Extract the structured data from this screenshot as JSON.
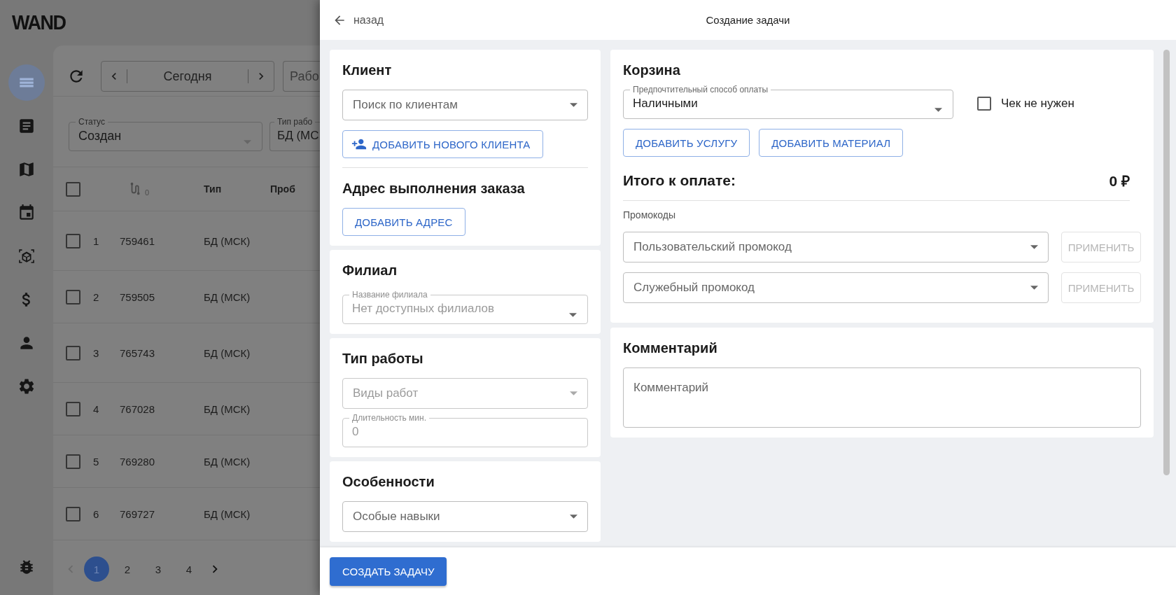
{
  "background_app": {
    "logo": "WAND",
    "nav": [
      {
        "kind": "menu",
        "selected": true
      },
      {
        "kind": "article",
        "selected": false
      },
      {
        "kind": "map",
        "selected": false
      },
      {
        "kind": "calendar",
        "selected": false
      },
      {
        "kind": "cube",
        "selected": false
      },
      {
        "kind": "money",
        "selected": false
      },
      {
        "kind": "person",
        "selected": false
      },
      {
        "kind": "settings",
        "selected": false
      },
      {
        "kind": "bug",
        "selected": false
      }
    ],
    "date_nav": {
      "label": "Сегодня"
    },
    "view_field": {
      "value": "Рабо"
    },
    "filters": [
      {
        "label": "Статус",
        "value": "Создан"
      },
      {
        "label": "Тип рабо",
        "value": "БД (МС"
      }
    ],
    "table": {
      "header_checked": false,
      "route_count": "0",
      "columns": [
        "Тип",
        "Проб"
      ],
      "rows": [
        {
          "index": "1",
          "id": "759461",
          "type": "БД (МСК)",
          "checked": false
        },
        {
          "index": "2",
          "id": "759505",
          "type": "БД (МСК)",
          "checked": false
        },
        {
          "index": "3",
          "id": "765743",
          "type": "БД (МСК)",
          "checked": false
        },
        {
          "index": "4",
          "id": "767028",
          "type": "БД (МСК)",
          "checked": false
        },
        {
          "index": "5",
          "id": "769280",
          "type": "БД (МСК)",
          "checked": false
        },
        {
          "index": "6",
          "id": "769727",
          "type": "БД (МСК)",
          "checked": false
        }
      ]
    },
    "pagination": [
      {
        "label": "1",
        "selected": true
      },
      {
        "label": "2",
        "selected": false
      },
      {
        "label": "3",
        "selected": false
      },
      {
        "label": "4",
        "selected": false
      }
    ]
  },
  "drawer": {
    "back": "назад",
    "title": "Создание задачи",
    "client": {
      "heading": "Клиент",
      "search": {
        "placeholder": "Поиск по клиентам"
      },
      "add_button": "ДОБАВИТЬ НОВОГО КЛИЕНТА"
    },
    "address": {
      "heading": "Адрес выполнения заказа",
      "add_button": "ДОБАВИТЬ АДРЕС"
    },
    "branch": {
      "heading": "Филиал",
      "field": {
        "label": "Название филиала",
        "value": "Нет доступных филиалов",
        "disabled": true
      }
    },
    "work_type": {
      "heading": "Тип работы",
      "kinds": {
        "placeholder": "Виды работ",
        "disabled": true
      },
      "duration": {
        "label": "Длительность мин.",
        "value": "0",
        "disabled": true
      }
    },
    "features": {
      "heading": "Особенности",
      "skills": {
        "placeholder": "Особые навыки",
        "disabled": false
      }
    },
    "cart": {
      "heading": "Корзина",
      "payment": {
        "label": "Предпочтительный способ оплаты",
        "value": "Наличными"
      },
      "no_receipt": {
        "label": "Чек не нужен",
        "checked": false
      },
      "buttons": [
        "ДОБАВИТЬ УСЛУГУ",
        "ДОБАВИТЬ МАТЕРИАЛ"
      ],
      "total_label": "Итого к оплате:",
      "total": "0 ₽",
      "promo_title": "Промокоды",
      "promos": [
        {
          "placeholder": "Пользовательский промокод",
          "apply": "ПРИМЕНИТЬ",
          "apply_disabled": true
        },
        {
          "placeholder": "Служебный промокод",
          "apply": "ПРИМЕНИТЬ",
          "apply_disabled": true
        }
      ]
    },
    "comment": {
      "heading": "Комментарий",
      "placeholder": "Комментарий"
    },
    "submit": "СОЗДАТЬ ЗАДАЧУ"
  }
}
